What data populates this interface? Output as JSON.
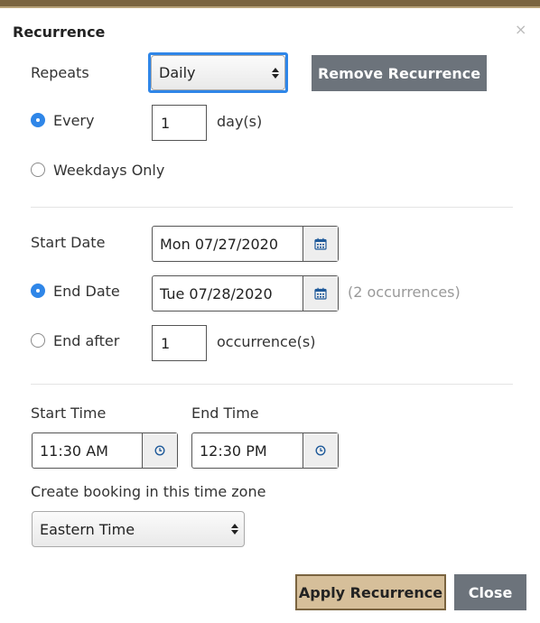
{
  "dialog": {
    "title": "Recurrence",
    "close_glyph": "×"
  },
  "repeats": {
    "label": "Repeats",
    "selected": "Daily",
    "remove_label": "Remove Recurrence"
  },
  "every": {
    "label": "Every",
    "value": "1",
    "unit": "day(s)",
    "checked": true
  },
  "weekdays": {
    "label": "Weekdays Only",
    "checked": false
  },
  "start_date": {
    "label": "Start Date",
    "value": "Mon 07/27/2020"
  },
  "end_date": {
    "label": "End Date",
    "value": "Tue 07/28/2020",
    "occurrences_note": "(2 occurrences)",
    "checked": true
  },
  "end_after": {
    "label": "End after",
    "value": "1",
    "unit": "occurrence(s)",
    "checked": false
  },
  "start_time": {
    "label": "Start Time",
    "value": "11:30 AM"
  },
  "end_time": {
    "label": "End Time",
    "value": "12:30 PM"
  },
  "timezone": {
    "label": "Create booking in this time zone",
    "selected": "Eastern Time"
  },
  "footer": {
    "apply_label": "Apply Recurrence",
    "close_label": "Close"
  },
  "colors": {
    "accent": "#2f86e8",
    "brand": "#7a6440",
    "apply_bg": "#d6bf9a",
    "button_gray": "#6c737b"
  },
  "icons": {
    "calendar": "calendar-icon",
    "clock": "clock-icon"
  }
}
